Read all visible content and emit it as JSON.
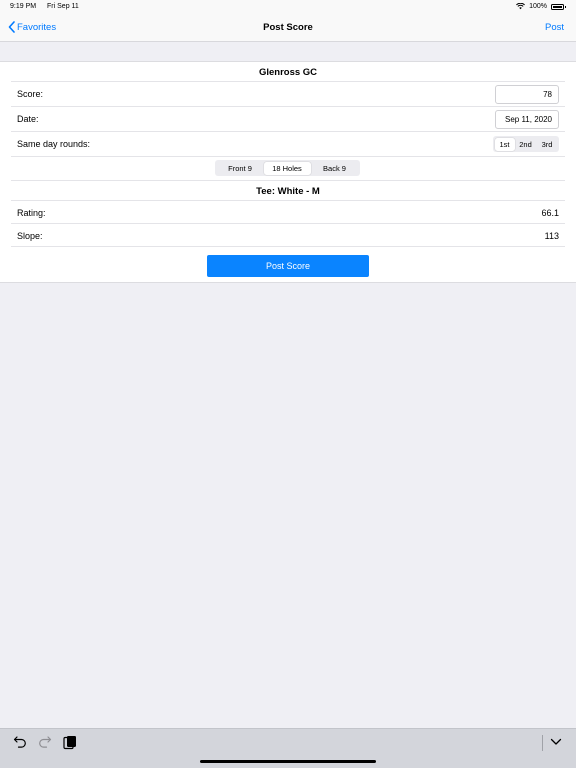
{
  "status_bar": {
    "time": "9:19 PM",
    "date": "Fri Sep 11",
    "battery": "100%"
  },
  "nav": {
    "back_label": "Favorites",
    "title": "Post Score",
    "action_label": "Post"
  },
  "course": {
    "name": "Glenross GC"
  },
  "form": {
    "score_label": "Score:",
    "score_value": "78",
    "date_label": "Date:",
    "date_value": "Sep 11, 2020",
    "same_day_label": "Same day rounds:",
    "same_day_options": [
      "1st",
      "2nd",
      "3rd"
    ],
    "same_day_selected": "1st",
    "holes_options": [
      "Front 9",
      "18 Holes",
      "Back 9"
    ],
    "holes_selected": "18 Holes"
  },
  "tee": {
    "title": "Tee: White - M",
    "rating_label": "Rating:",
    "rating_value": "66.1",
    "slope_label": "Slope:",
    "slope_value": "113"
  },
  "actions": {
    "post_score_label": "Post Score"
  },
  "colors": {
    "accent": "#007aff",
    "button": "#0a84ff",
    "background": "#efeff4"
  },
  "toolbar": {
    "icons": [
      "undo-icon",
      "redo-icon",
      "paste-icon",
      "chevron-down-icon"
    ]
  }
}
